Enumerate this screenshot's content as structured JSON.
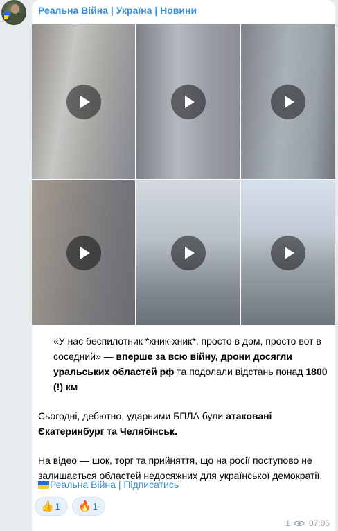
{
  "channel": {
    "name": "Реальна Війна | Україна | Новини"
  },
  "media": {
    "videos": [
      {
        "label": "video-1"
      },
      {
        "label": "video-2"
      },
      {
        "label": "video-3"
      },
      {
        "label": "video-4"
      },
      {
        "label": "video-5"
      },
      {
        "label": "video-6"
      }
    ]
  },
  "post": {
    "p1_a": "«У нас беспилотник *хник-хник*, просто в дом, просто вот в соседний» — ",
    "p1_b": "вперше за всю війну, дрони досягли уральських областей рф",
    "p1_c": " та подолали відстань понад ",
    "p1_d": "1800 (!) км",
    "p2_a": "Сьогодні, дебютно, ударними БПЛА були ",
    "p2_b": "атаковані Єкатеринбург та Челябінськ.",
    "p3": "На відео — шок, торг та прийняття, що на росії поступово не залишається областей недосяжних для української демократії.",
    "signature": "Реальна Війна | Підписатись"
  },
  "reactions": [
    {
      "emoji": "👍",
      "count": "1"
    },
    {
      "emoji": "🔥",
      "count": "1"
    }
  ],
  "meta": {
    "views": "1",
    "time": "07:05"
  },
  "colors": {
    "accent": "#3a8bd6",
    "background": "#e6ebee",
    "bubble": "#ffffff"
  }
}
